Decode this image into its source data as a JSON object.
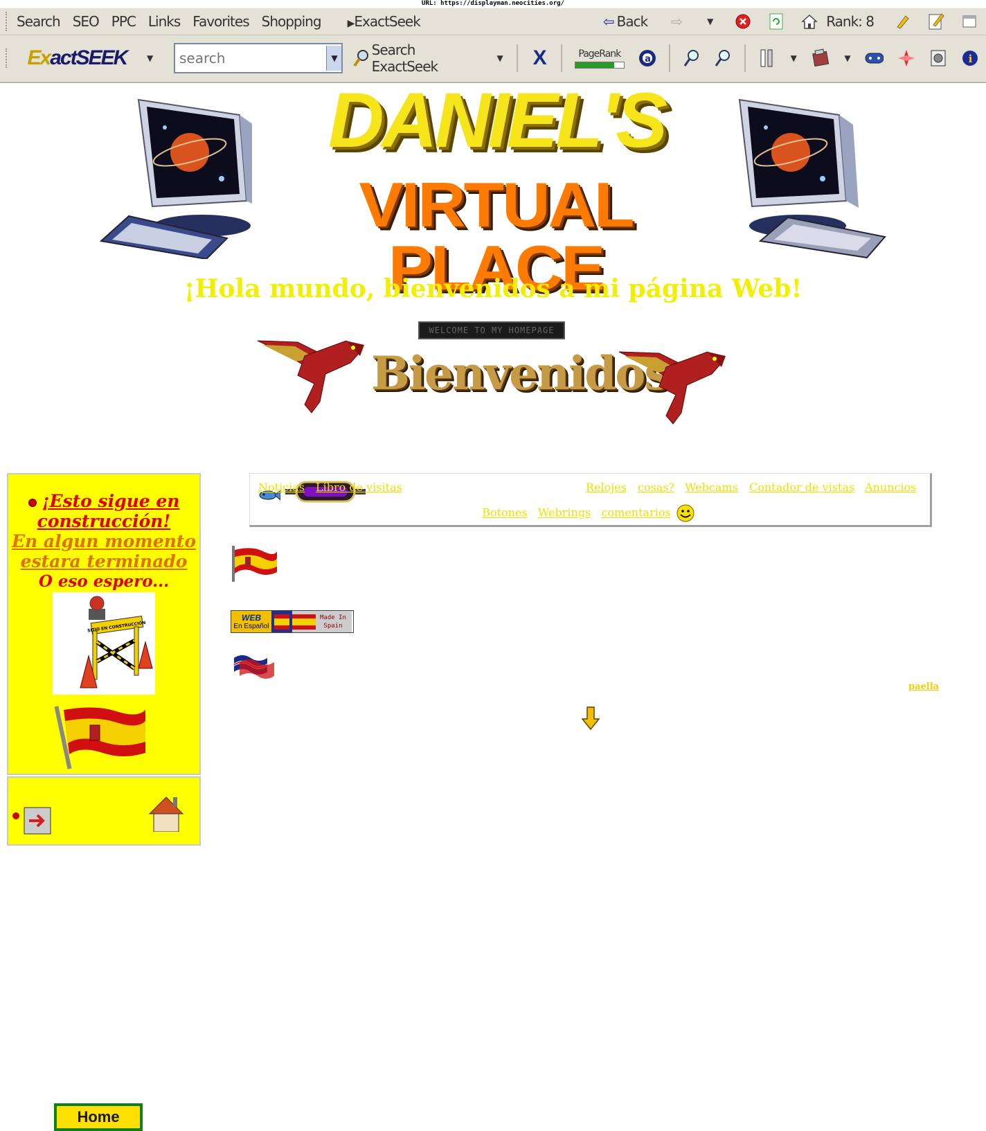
{
  "url_caption": "URL: https://displayman.neocities.org/",
  "toolbar": {
    "menu": [
      "Search",
      "SEO",
      "PPC",
      "Links",
      "Favorites",
      "Shopping"
    ],
    "exactseek_menu": "ExactSeek",
    "back_label": "Back",
    "rank_label": "Rank: 8",
    "logo_prefix": "Ex",
    "logo_rest": "actSEEK",
    "search_placeholder": "search",
    "search_button_label": "Search ExactSeek",
    "pagerank_label": "PageRank",
    "pagerank_fraction": 0.8
  },
  "banner": {
    "title_line1": "DANIEL'S",
    "title_line2": "VIRTUAL PLACE"
  },
  "greeting": "¡Hola mundo, bienvenidos a mi página Web!",
  "marquee_text": "WELCOME TO MY HOMEPAGE",
  "bienvenidos": "Bienvenidos",
  "sidebar": {
    "line1": "¡Esto sigue en construcción!",
    "line2": " En algun momento estara terminado",
    "line3": "O eso espero...",
    "home_label": "Home",
    "construction_sign": "SITIO EN CONSTRUCCIÓN"
  },
  "nav": {
    "links_row1": [
      "Noticias",
      "Libro de visitas",
      "Relojes",
      "cosas?",
      "Webcams",
      "Contador de vistas",
      "Anuncios"
    ],
    "links_row2": [
      "Botones",
      "Webrings",
      "comentarios"
    ]
  },
  "badges": {
    "web_top": "WEB",
    "web_bottom": "En Español",
    "made_in": "Made In",
    "spain": "Spain"
  },
  "paella_link": "paella",
  "colors": {
    "link_yellow": "#f0e000",
    "greeting_yellow": "#f1f000",
    "sidebar_bg": "#ffff00",
    "title_yellow": "#f5e51a",
    "title_orange": "#ff7a00"
  }
}
